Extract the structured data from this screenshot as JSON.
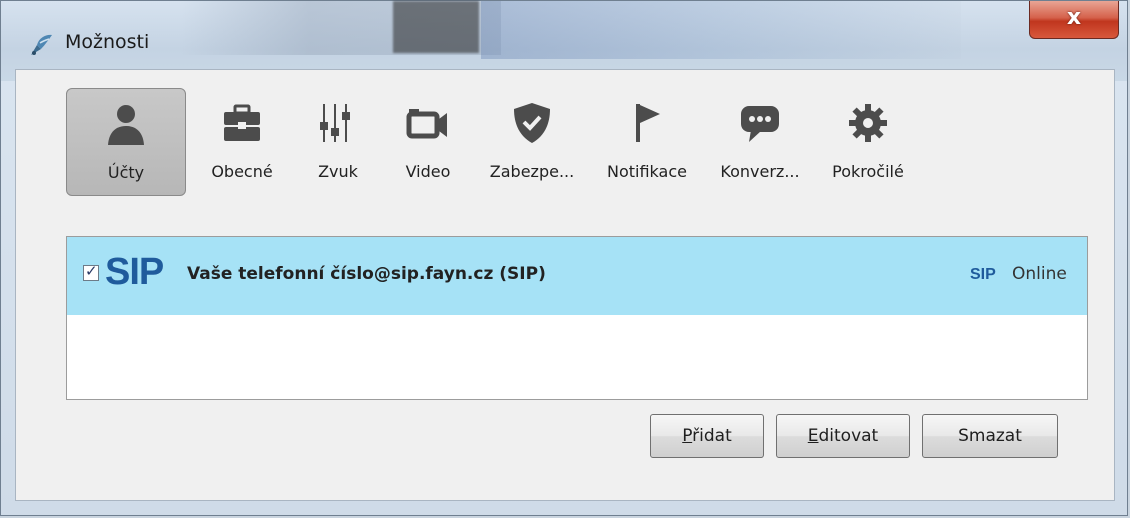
{
  "window": {
    "title": "Možnosti"
  },
  "close_label": "x",
  "tabs": [
    {
      "label": "Účty",
      "icon": "user-icon",
      "active": true
    },
    {
      "label": "Obecné",
      "icon": "briefcase-icon"
    },
    {
      "label": "Zvuk",
      "icon": "equalizer-icon"
    },
    {
      "label": "Video",
      "icon": "video-camera-icon"
    },
    {
      "label": "Zabezpe...",
      "icon": "shield-icon"
    },
    {
      "label": "Notifikace",
      "icon": "flag-icon"
    },
    {
      "label": "Konverz...",
      "icon": "chat-bubble-icon"
    },
    {
      "label": "Pokročilé",
      "icon": "gear-icon"
    }
  ],
  "account": {
    "checked": true,
    "logo": "SIP",
    "name": "Vaše telefonní číslo@sip.fayn.cz (SIP)",
    "protocol": "SIP",
    "status": "Online"
  },
  "buttons": {
    "add": {
      "mnemonic": "P",
      "rest": "řidat"
    },
    "edit": {
      "mnemonic": "E",
      "rest": "ditovat"
    },
    "delete": {
      "label": "Smazat"
    }
  },
  "colors": {
    "selected_row": "#a6e2f6",
    "sip_blue": "#1f5b9c",
    "close_red": "#c0361e"
  }
}
